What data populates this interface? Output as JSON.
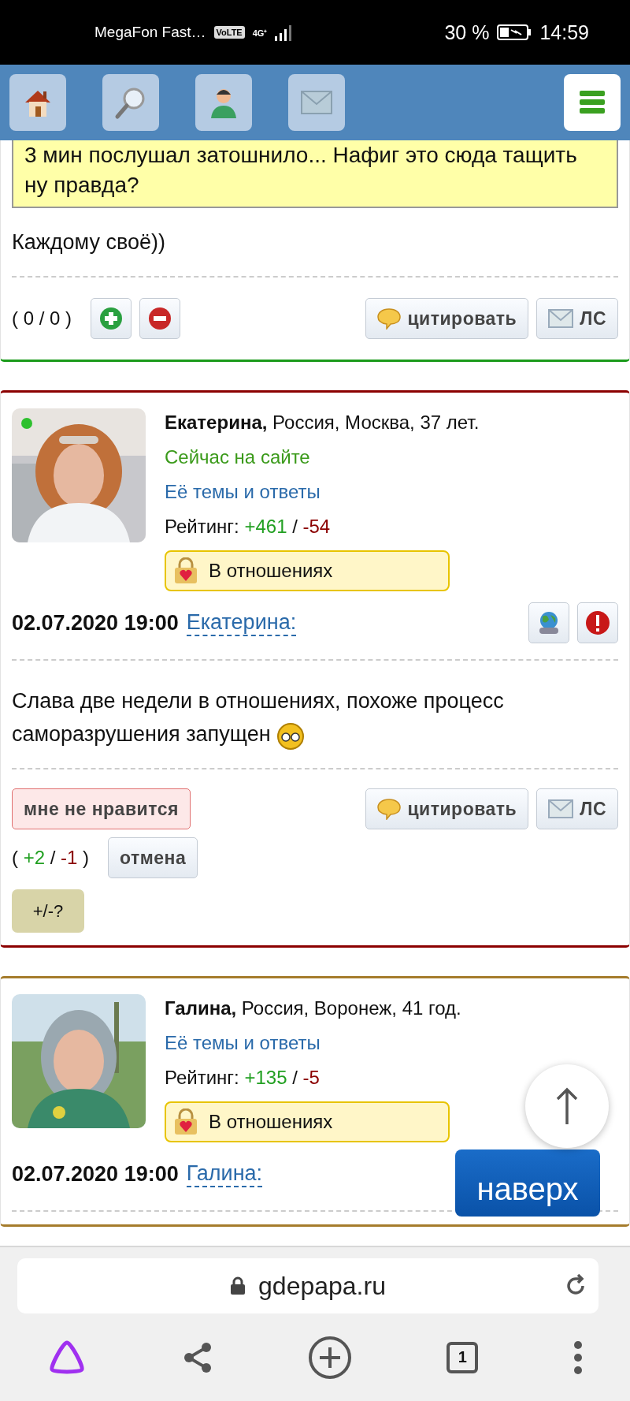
{
  "status_bar": {
    "carrier": "MegaFon Fast…",
    "volte": "VoLTE",
    "network": "4G⁺",
    "battery": "30 %",
    "time": "14:59"
  },
  "toolbar": {
    "buttons": [
      {
        "kind": "home"
      },
      {
        "kind": "search"
      },
      {
        "kind": "profile"
      },
      {
        "kind": "mail"
      }
    ],
    "menu": {
      "kind": "menu"
    }
  },
  "posts": [
    {
      "color": "#1a9a1a",
      "quote": "3 мин послушал затошнило... Нафиг это сюда тащить ну правда?",
      "text": "Каждому своё))",
      "score": {
        "kind": "plain",
        "text": "( 0 / 0 )"
      },
      "vote_buttons": [
        {
          "kind": "plus"
        },
        {
          "kind": "minus"
        }
      ],
      "cite": "цитировать",
      "pm": "ЛС"
    },
    {
      "color": "#8b0000",
      "author": {
        "line": "**Екатерина,** Россия, Москва, 37 лет.",
        "online": true,
        "status": "Сейчас на сайте",
        "topics_link": "Её темы и ответы",
        "rating_label": "Рейтинг:",
        "rating_plus": "+461",
        "rating_sep": "/",
        "rating_minus": "-54",
        "badge": "В отношениях"
      },
      "date": "02.07.2020 19:00",
      "author_link": "Екатерина:",
      "text_lines": [
        "Слава две недели в отношениях, похоже процесс",
        "саморазрушения запущен"
      ],
      "emoticon": {
        "kind": "smiley"
      },
      "icons": [
        {
          "kind": "link"
        },
        {
          "kind": "report"
        }
      ],
      "dislike": "мне не нравится",
      "cite": "цитировать",
      "pm": "ЛС",
      "score": {
        "kind": "colored",
        "open": "(",
        "plus": "+2",
        "sep": "/",
        "minus": "-1",
        "close": ")"
      },
      "cancel": "отмена",
      "help": "+/-?"
    },
    {
      "color": "#a57c2c",
      "author": {
        "line": "**Галина,** Россия, Воронеж, 41 год.",
        "topics_link": "Её темы и ответы",
        "rating_label": "Рейтинг:",
        "rating_plus": "+135",
        "rating_sep": "/",
        "rating_minus": "-5",
        "badge": "В отношениях"
      },
      "date": "02.07.2020 19:00",
      "author_link": "Галина:"
    }
  ],
  "scroll_top": {
    "label": "наверх"
  },
  "browser": {
    "url": "gdepapa.ru",
    "tab_count": "1"
  }
}
